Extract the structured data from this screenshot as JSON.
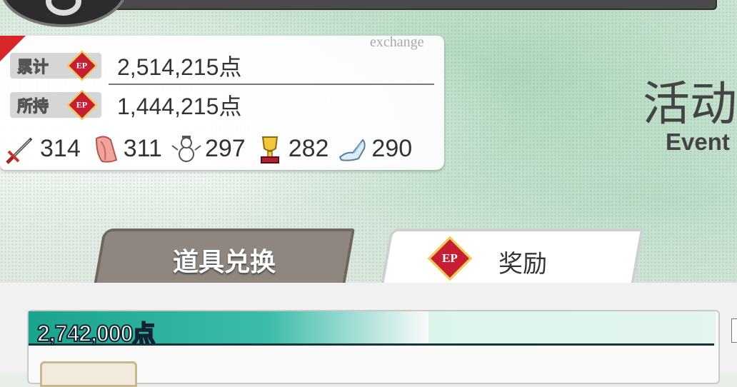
{
  "header": {
    "title_cn": "活动",
    "title_en": "Event",
    "tag": "exchange"
  },
  "points": {
    "total_label": "累计",
    "total_value": "2,514,215点",
    "held_label": "所持",
    "held_value": "1,444,215点",
    "badge": "EP"
  },
  "items": [
    {
      "icon": "sword-icon",
      "value": "314"
    },
    {
      "icon": "cloth-icon",
      "value": "311"
    },
    {
      "icon": "snowman-icon",
      "value": "297"
    },
    {
      "icon": "trophy-icon",
      "value": "282"
    },
    {
      "icon": "glass-slipper-icon",
      "value": "290"
    }
  ],
  "tabs": [
    {
      "label": "道具兑换",
      "active": false
    },
    {
      "label": "奖励",
      "active": true
    }
  ],
  "reward": {
    "threshold": "2,742,000点"
  },
  "colors": {
    "ep_red": "#c81e34",
    "ep_gold": "#f2d24a",
    "teal": "#1aa48e"
  }
}
